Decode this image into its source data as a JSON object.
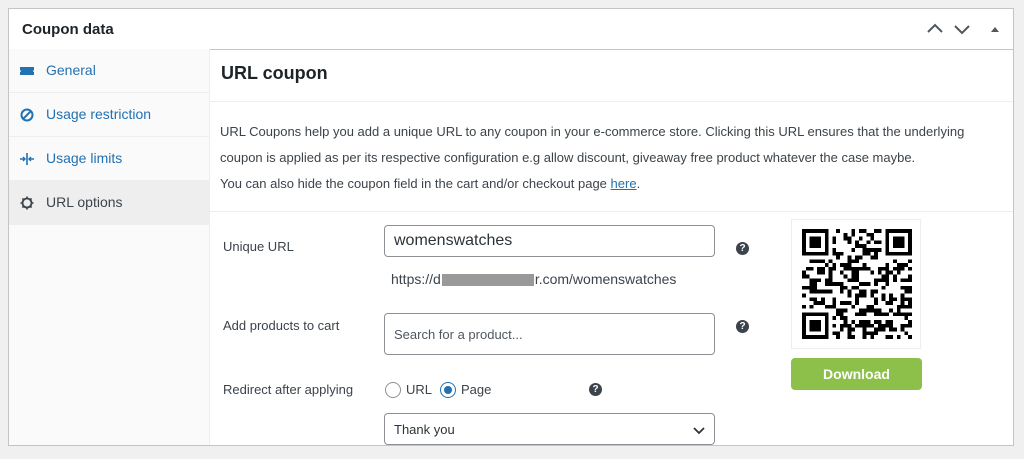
{
  "panel": {
    "title": "Coupon data"
  },
  "sidebar": {
    "items": [
      {
        "label": "General",
        "icon": "ticket-icon"
      },
      {
        "label": "Usage restriction",
        "icon": "ban-icon"
      },
      {
        "label": "Usage limits",
        "icon": "limits-icon"
      },
      {
        "label": "URL options",
        "icon": "gear-icon"
      }
    ],
    "active_index": 3
  },
  "main": {
    "section_title": "URL coupon",
    "description_line1": "URL Coupons help you add a unique URL to any coupon in your e-commerce store. Clicking this URL ensures that the underlying",
    "description_line2": "coupon is applied as per its respective configuration e.g allow discount, giveaway free product whatever the case maybe.",
    "description_line3": "You can also hide the coupon field in the cart and/or checkout page ",
    "description_link": "here",
    "description_end": "."
  },
  "form": {
    "unique_url_label": "Unique URL",
    "unique_url_value": "womenswatches",
    "url_prefix": "https://d",
    "url_suffix": "r.com/womenswatches",
    "add_products_label": "Add products to cart",
    "add_products_placeholder": "Search for a product...",
    "redirect_label": "Redirect after applying",
    "redirect_options": [
      "URL",
      "Page"
    ],
    "redirect_selected": "Page",
    "page_select_value": "Thank you",
    "help_glyph": "?"
  },
  "qr": {
    "download_label": "Download"
  },
  "colors": {
    "accent": "#2271b1",
    "download": "#8cc04b"
  }
}
